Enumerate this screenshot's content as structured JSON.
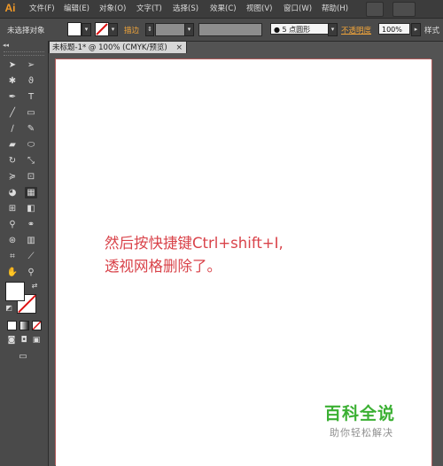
{
  "app": {
    "logo": "Ai"
  },
  "menu": [
    "文件(F)",
    "编辑(E)",
    "对象(O)",
    "文字(T)",
    "选择(S)",
    "效果(C)",
    "视图(V)",
    "窗口(W)",
    "帮助(H)"
  ],
  "options": {
    "selection_status": "未选择对象",
    "stroke_label": "描边",
    "brush_label": "5 点圆形",
    "opacity_label": "不透明度",
    "opacity_value": "100%",
    "style_label": "样式"
  },
  "document_tab": {
    "title": "未标题-1* @ 100% (CMYK/预览)",
    "close": "×"
  },
  "canvas": {
    "caption_line1": "然后按快捷键Ctrl+shift+I,",
    "caption_line2": "透视网格删除了。"
  },
  "watermark": {
    "title": "百科全说",
    "subtitle": "助你轻松解决"
  },
  "colors": {
    "accent": "#f39a27",
    "caption": "#d9434a",
    "watermark": "#3bb033"
  }
}
